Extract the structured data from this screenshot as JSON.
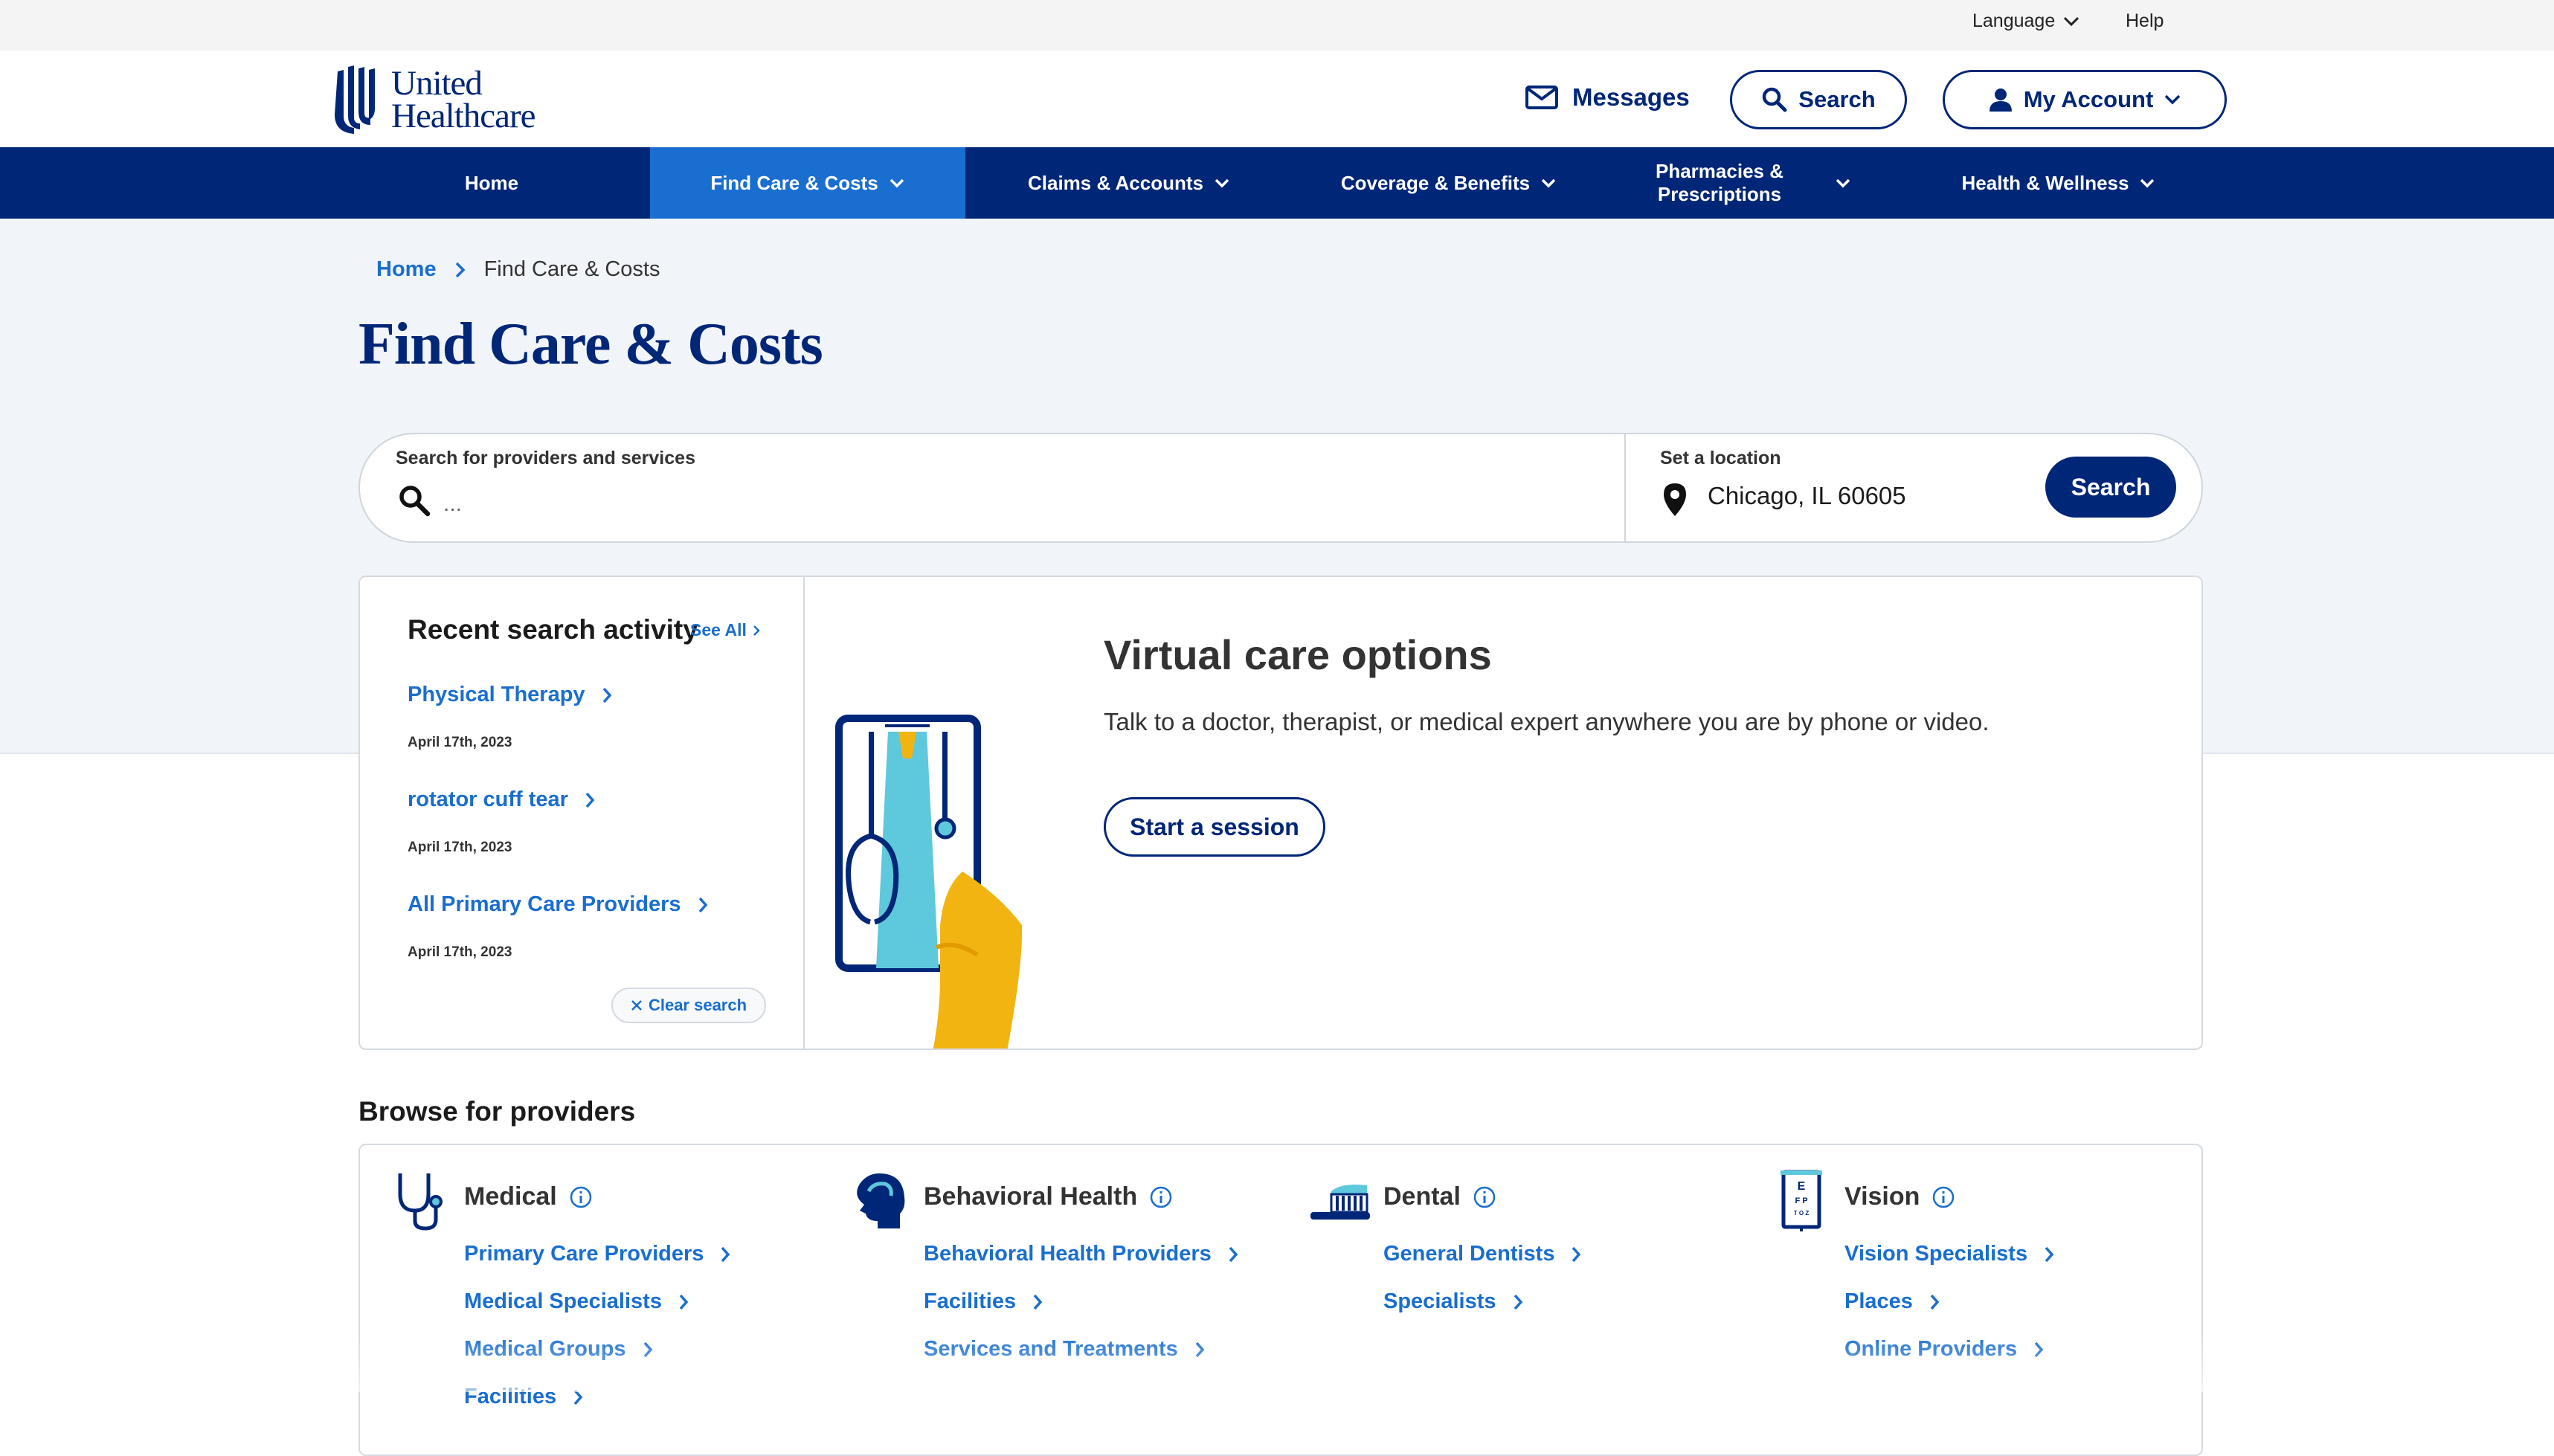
{
  "utility": {
    "language_label": "Language",
    "help_label": "Help"
  },
  "header": {
    "logo_line1": "United",
    "logo_line2": "Healthcare",
    "messages_label": "Messages",
    "search_label": "Search",
    "account_label": "My Account"
  },
  "nav": {
    "items": [
      {
        "label": "Home"
      },
      {
        "label": "Find Care & Costs"
      },
      {
        "label": "Claims & Accounts"
      },
      {
        "label": "Coverage & Benefits"
      },
      {
        "label": "Pharmacies & Prescriptions"
      },
      {
        "label": "Health & Wellness"
      }
    ]
  },
  "breadcrumb": {
    "home": "Home",
    "current": "Find Care & Costs"
  },
  "page": {
    "title": "Find Care & Costs"
  },
  "search": {
    "label": "Search for providers and services",
    "placeholder": "...",
    "location_label": "Set a location",
    "location_value": "Chicago, IL 60605",
    "button_label": "Search"
  },
  "recent": {
    "title": "Recent search activity",
    "see_all": "See All",
    "items": [
      {
        "label": "Physical Therapy",
        "date": "April 17th, 2023"
      },
      {
        "label": "rotator cuff tear",
        "date": "April 17th, 2023"
      },
      {
        "label": "All Primary Care Providers",
        "date": "April 17th, 2023"
      }
    ],
    "clear_label": "Clear search"
  },
  "virtual_care": {
    "title": "Virtual care options",
    "description": "Talk to a doctor, therapist, or medical expert anywhere you are by phone or video.",
    "button_label": "Start a session"
  },
  "browse": {
    "title": "Browse for providers",
    "categories": [
      {
        "title": "Medical",
        "icon": "stethoscope-icon",
        "links": [
          "Primary Care Providers",
          "Medical Specialists",
          "Medical Groups",
          "Facilities"
        ]
      },
      {
        "title": "Behavioral Health",
        "icon": "head-profile-icon",
        "links": [
          "Behavioral Health Providers",
          "Facilities",
          "Services and Treatments"
        ]
      },
      {
        "title": "Dental",
        "icon": "toothbrush-icon",
        "links": [
          "General Dentists",
          "Specialists"
        ]
      },
      {
        "title": "Vision",
        "icon": "eye-chart-icon",
        "links": [
          "Vision Specialists",
          "Places",
          "Online Providers"
        ]
      }
    ]
  },
  "colors": {
    "brand_navy": "#002677",
    "link_blue": "#196ecf",
    "accent_gold": "#f2b411",
    "accent_cyan": "#5ec8dc"
  }
}
